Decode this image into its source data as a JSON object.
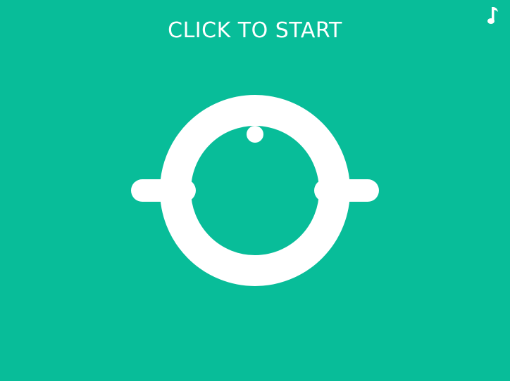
{
  "start_prompt": "CLICK TO START",
  "colors": {
    "background": "#08bd99",
    "foreground": "#ffffff"
  },
  "icons": {
    "music_toggle": "music-note-icon"
  }
}
